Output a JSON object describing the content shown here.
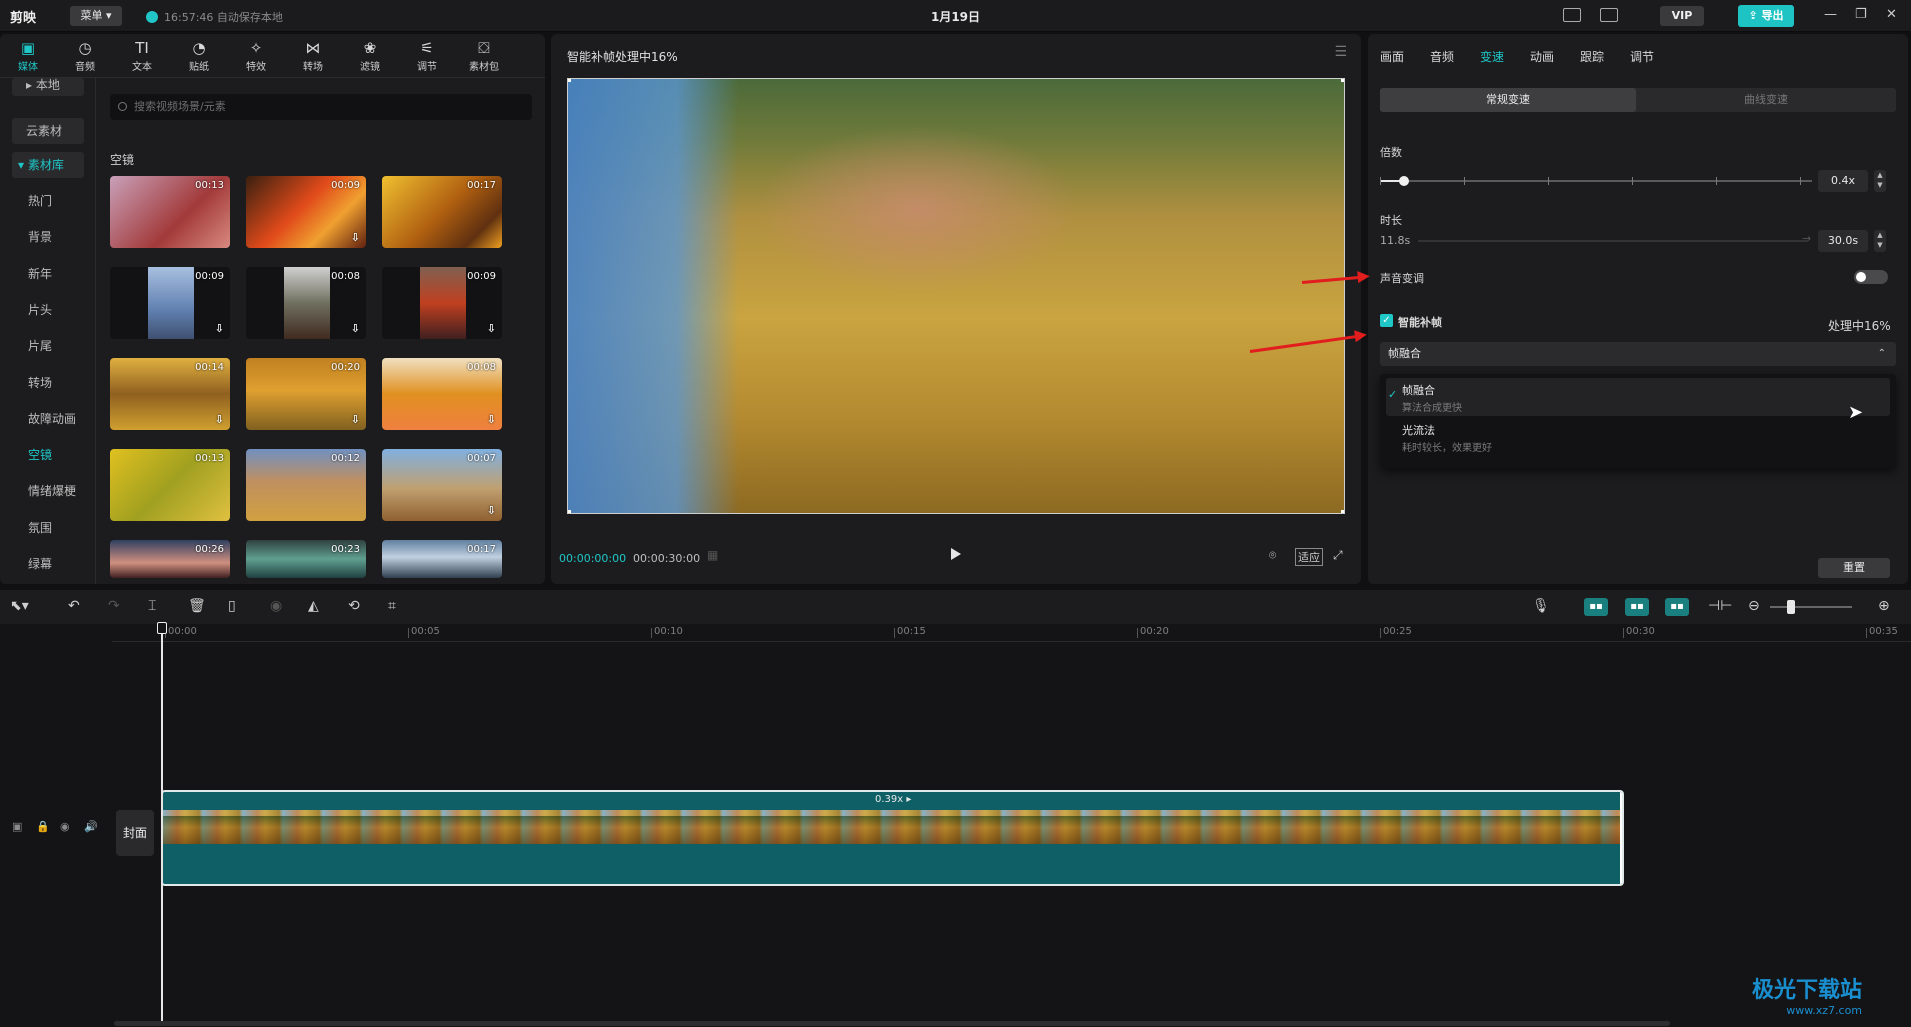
{
  "titlebar": {
    "logo": "剪映",
    "menu_label": "菜单",
    "autosave": "16:57:46 自动保存本地",
    "title": "1月19日",
    "vip": "VIP",
    "export": "导出"
  },
  "tool_tabs": [
    {
      "label": "媒体",
      "icon": "media-icon",
      "glyph": "▣"
    },
    {
      "label": "音频",
      "icon": "audio-icon",
      "glyph": "◷"
    },
    {
      "label": "文本",
      "icon": "text-icon",
      "glyph": "TI"
    },
    {
      "label": "贴纸",
      "icon": "sticker-icon",
      "glyph": "◔"
    },
    {
      "label": "特效",
      "icon": "effects-icon",
      "glyph": "✧"
    },
    {
      "label": "转场",
      "icon": "transition-icon",
      "glyph": "⋈"
    },
    {
      "label": "滤镜",
      "icon": "filter-icon",
      "glyph": "❀"
    },
    {
      "label": "调节",
      "icon": "adjust-icon",
      "glyph": "⚟"
    },
    {
      "label": "素材包",
      "icon": "package-icon",
      "glyph": "⛋"
    }
  ],
  "side_nav": {
    "local": "本地",
    "cloud": "云素材",
    "library": "素材库",
    "items": [
      "热门",
      "背景",
      "新年",
      "片头",
      "片尾",
      "转场",
      "故障动画",
      "空镜",
      "情绪爆梗",
      "氛围",
      "绿幕"
    ],
    "active": "空镜"
  },
  "search_placeholder": "搜索视频场景/元素",
  "section_title": "空镜",
  "thumbnails": [
    {
      "duration": "00:13",
      "download": ""
    },
    {
      "duration": "00:09",
      "download": "⇩"
    },
    {
      "duration": "00:17",
      "download": ""
    },
    {
      "duration": "00:09",
      "download": "⇩"
    },
    {
      "duration": "00:08",
      "download": "⇩"
    },
    {
      "duration": "00:09",
      "download": "⇩"
    },
    {
      "duration": "00:14",
      "download": "⇩"
    },
    {
      "duration": "00:20",
      "download": "⇩"
    },
    {
      "duration": "00:08",
      "download": "⇩"
    },
    {
      "duration": "00:13",
      "download": ""
    },
    {
      "duration": "00:12",
      "download": ""
    },
    {
      "duration": "00:07",
      "download": "⇩"
    },
    {
      "duration": "00:26",
      "download": ""
    },
    {
      "duration": "00:23",
      "download": ""
    },
    {
      "duration": "00:17",
      "download": ""
    }
  ],
  "preview": {
    "title": "智能补帧处理中16%",
    "current_time": "00:00:00:00",
    "total_time": "00:00:30:00",
    "ratio_label": "适应"
  },
  "props": {
    "tabs": [
      "画面",
      "音频",
      "变速",
      "动画",
      "跟踪",
      "调节"
    ],
    "active_tab": "变速",
    "speed_modes": [
      "常规变速",
      "曲线变速"
    ],
    "multiplier_label": "倍数",
    "multiplier_value": "0.4x",
    "duration_label": "时长",
    "duration_original": "11.8s",
    "duration_value": "30.0s",
    "pitch_label": "声音变调",
    "smart_frame_label": "智能补帧",
    "processing": "处理中16%",
    "select_value": "帧融合",
    "options": [
      {
        "title": "帧融合",
        "desc": "算法合成更快"
      },
      {
        "title": "光流法",
        "desc": "耗时较长，效果更好"
      }
    ],
    "reset": "重置"
  },
  "timeline": {
    "ruler": [
      "00:00",
      "00:05",
      "00:10",
      "00:15",
      "00:20",
      "00:25",
      "00:30",
      "00:35"
    ],
    "cover_label": "封面",
    "clip_speed": "0.39x ▸"
  },
  "watermark": {
    "name": "极光下载站",
    "url": "www.xz7.com"
  },
  "colors": {
    "accent": "#1fc7c7",
    "annotation_arrow": "#e11d1d",
    "clip": "#0f5f66"
  }
}
